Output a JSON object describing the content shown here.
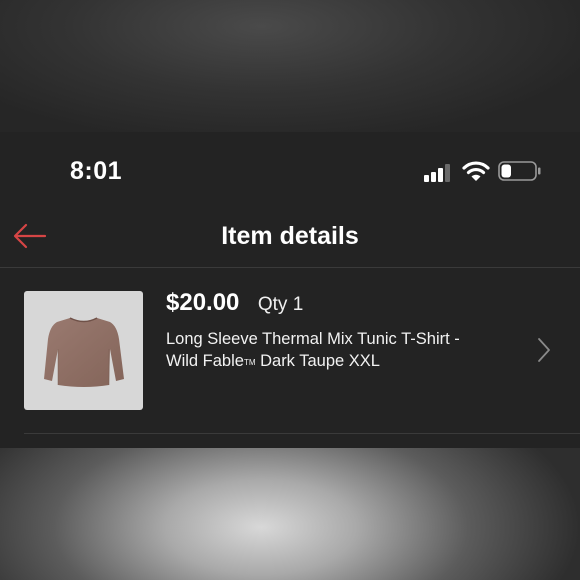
{
  "status_bar": {
    "time": "8:01",
    "signal_bars": 3,
    "battery_level": 0.3
  },
  "header": {
    "back_icon": "arrow-left-icon",
    "title": "Item details"
  },
  "item": {
    "price": "$20.00",
    "qty": "Qty 1",
    "description_line1": "Long Sleeve Thermal Mix Tunic T-Shirt -",
    "description_line2_brand": "Wild Fable",
    "trademark": "TM",
    "description_line2_rest": " Dark Taupe XXL",
    "image_icon": "taupe-long-sleeve-shirt-image",
    "chevron_icon": "chevron-right-icon"
  },
  "colors": {
    "background": "#232323",
    "accent_back_arrow": "#d64545",
    "shirt_color": "#8e6f66",
    "thumbnail_bg": "#d7d7d7"
  }
}
